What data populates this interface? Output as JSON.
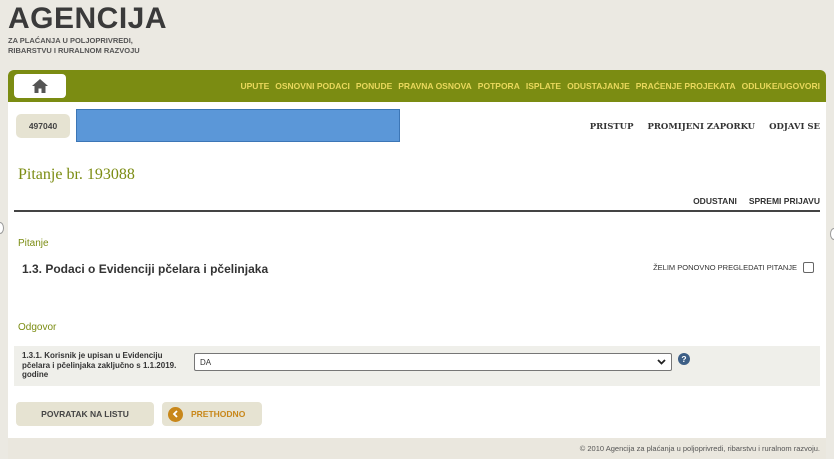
{
  "logo": {
    "title": "AGENCIJA",
    "subtitle_line1": "ZA PLAĆANJA U POLJOPRIVREDI,",
    "subtitle_line2": "RIBARSTVU I RURALNOM RAZVOJU"
  },
  "nav": {
    "home_icon": "home-icon",
    "items": [
      "UPUTE",
      "OSNOVNI PODACI",
      "PONUDE",
      "PRAVNA OSNOVA",
      "POTPORA",
      "ISPLATE",
      "ODUSTAJANJE",
      "PRAĆENJE PROJEKATA",
      "ODLUKE/UGOVORI"
    ]
  },
  "user": {
    "id": "497040",
    "links": [
      "PRISTUP",
      "PROMIJENI ZAPORKU",
      "ODJAVI SE"
    ]
  },
  "question": {
    "title": "Pitanje br. 193088",
    "actions": [
      "ODUSTANI",
      "SPREMI PRIJAVU"
    ],
    "section_label": "Pitanje",
    "text": "1.3. Podaci o Evidenciji pčelara i pčelinjaka",
    "review_label": "ŽELIM PONOVNO PREGLEDATI PITANJE",
    "review_checked": false
  },
  "answer": {
    "section_label": "Odgovor",
    "field_label": "1.3.1. Korisnik je upisan u Evidenciju pčelara i pčelinjaka zaključno s 1.1.2019. godine",
    "selected_value": "DA",
    "help_icon": "help-icon"
  },
  "buttons": {
    "back_label": "POVRATAK NA LISTU",
    "prev_label": "PRETHODNO",
    "prev_icon": "chevron-left-icon"
  },
  "footer": {
    "text": "© 2010 Agencija za plaćanja u poljoprivredi, ribarstvu i ruralnom razvoju."
  },
  "colors": {
    "nav_bg": "#7b8c12",
    "nav_text": "#e9d85c",
    "accent_green": "#7b8c12",
    "prev_orange": "#c8871a",
    "redaction_blue": "#5b97d8"
  }
}
